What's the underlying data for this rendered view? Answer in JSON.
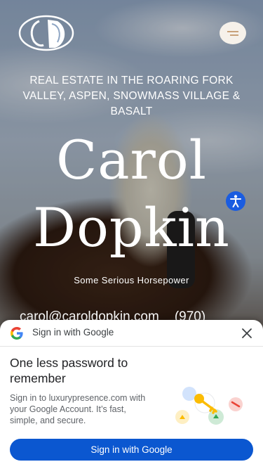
{
  "hero": {
    "tagline": "REAL ESTATE IN THE ROARING FORK VALLEY, ASPEN, SNOWMASS VILLAGE & BASALT",
    "name_first": "Carol",
    "name_last": "Dopkin",
    "subtitle": "Some Serious Horsepower",
    "email": "carol@caroldopkin.com",
    "phone": "(970)",
    "logo_icon": "horse-head-logo-icon",
    "menu_icon": "hamburger-menu-icon",
    "accessibility_icon": "accessibility-person-icon"
  },
  "google_prompt": {
    "header_title": "Sign in with Google",
    "headline": "One less password to remember",
    "description": "Sign in to luxurypresence.com with your Google Account. It’s fast, simple, and secure.",
    "button_label": "Sign in with Google",
    "close_icon": "close-icon",
    "brand_color": "#0b57d0"
  }
}
